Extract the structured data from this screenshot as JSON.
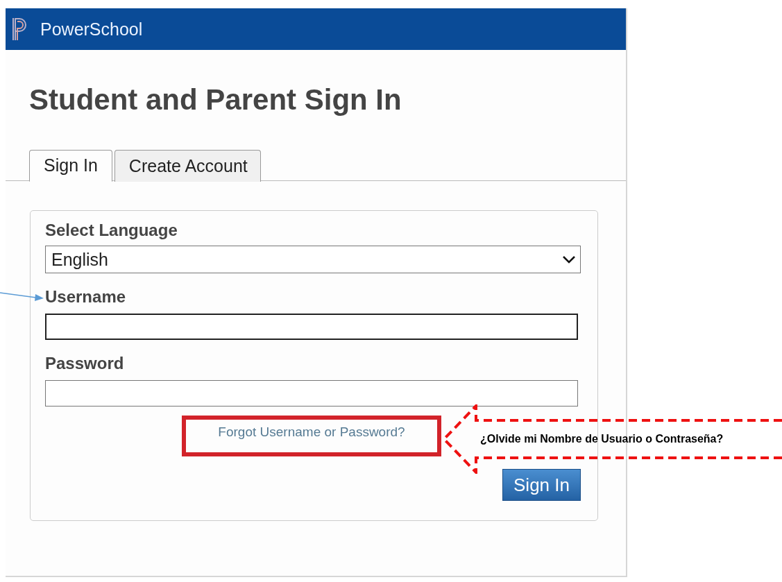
{
  "header": {
    "brand": "PowerSchool"
  },
  "title": "Student and Parent Sign In",
  "tabs": [
    {
      "label": "Sign In",
      "selected": true
    },
    {
      "label": "Create Account",
      "selected": false
    }
  ],
  "form": {
    "language_label": "Select Language",
    "language_value": "English",
    "username_label": "Username",
    "password_label": "Password",
    "forgot_link": "Forgot Username or Password?",
    "submit": "Sign In"
  },
  "annotation": {
    "callout_text": "¿Olvide mi Nombre de Usuario o Contraseña?"
  }
}
